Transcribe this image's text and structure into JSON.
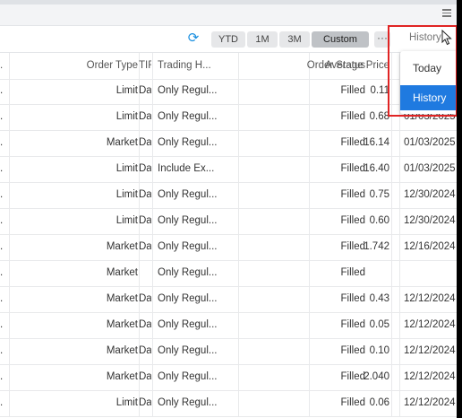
{
  "toolbar": {
    "refresh_icon": "refresh-icon",
    "ranges": [
      {
        "label": "YTD",
        "active": false
      },
      {
        "label": "1M",
        "active": false
      },
      {
        "label": "3M",
        "active": false
      },
      {
        "label": "Custom",
        "active": true
      }
    ],
    "more_label": "···",
    "dropdown_value": "History"
  },
  "dropdown": {
    "options": [
      {
        "label": "Today",
        "selected": false
      },
      {
        "label": "History",
        "selected": true
      }
    ],
    "highlight_color": "#e02424",
    "selected_color": "#1f7ae0"
  },
  "table": {
    "headers": [
      ".",
      "Order Type",
      "TIF",
      "Trading H...",
      "Order Status",
      "Average Price",
      ""
    ],
    "rows": [
      [
        ".",
        "Limit",
        "Day",
        "Only Regul...",
        "Filled",
        "0.11",
        ""
      ],
      [
        ".",
        "Limit",
        "Day",
        "Only Regul...",
        "Filled",
        "0.68",
        "01/03/2025"
      ],
      [
        ".",
        "Market",
        "Day",
        "Only Regul...",
        "Filled",
        "16.14",
        "01/03/2025"
      ],
      [
        ".",
        "Limit",
        "Day",
        "Include Ex...",
        "Filled",
        "16.40",
        "01/03/2025"
      ],
      [
        ".",
        "Limit",
        "Day",
        "Only Regul...",
        "Filled",
        "0.75",
        "12/30/2024"
      ],
      [
        ".",
        "Limit",
        "Day",
        "Only Regul...",
        "Filled",
        "0.60",
        "12/30/2024"
      ],
      [
        ".",
        "Market",
        "Day",
        "Only Regul...",
        "Filled",
        "1.742",
        "12/16/2024"
      ],
      [
        ".",
        "Market",
        "",
        "Only Regul...",
        "Filled",
        "",
        ""
      ],
      [
        ".",
        "Market",
        "Day",
        "Only Regul...",
        "Filled",
        "0.43",
        "12/12/2024"
      ],
      [
        ".",
        "Market",
        "Day",
        "Only Regul...",
        "Filled",
        "0.05",
        "12/12/2024"
      ],
      [
        ".",
        "Market",
        "Day",
        "Only Regul...",
        "Filled",
        "0.10",
        "12/12/2024"
      ],
      [
        ".",
        "Market",
        "Day",
        "Only Regul...",
        "Filled",
        "2.040",
        "12/12/2024"
      ],
      [
        ".",
        "Limit",
        "Day",
        "Only Regul...",
        "Filled",
        "0.06",
        "12/12/2024"
      ]
    ]
  }
}
